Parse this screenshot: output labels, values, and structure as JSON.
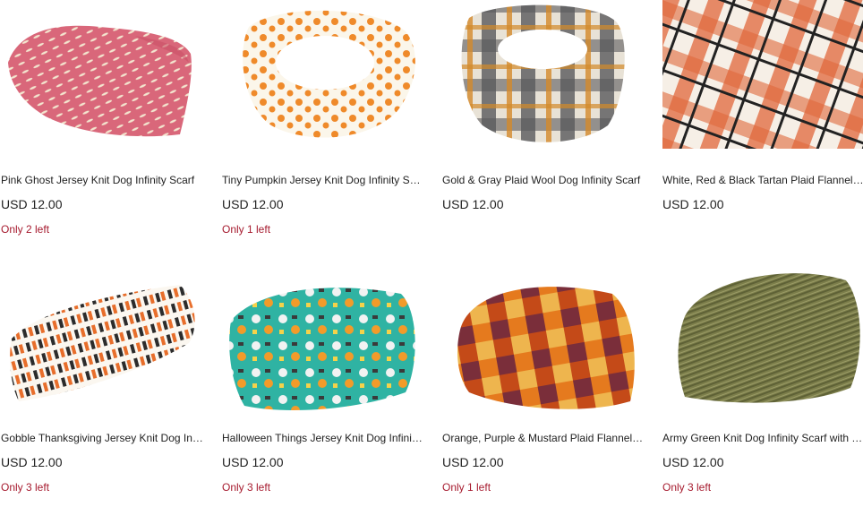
{
  "listings": [
    {
      "title": "Pink Ghost Jersey Knit Dog Infinity Scarf",
      "price": "USD 12.00",
      "stock": "Only 2 left",
      "image": "pink-ghost-scarf"
    },
    {
      "title": "Tiny Pumpkin Jersey Knit Dog Infinity Scarf",
      "price": "USD 12.00",
      "stock": "Only 1 left",
      "image": "tiny-pumpkin-scarf"
    },
    {
      "title": "Gold & Gray Plaid Wool Dog Infinity Scarf",
      "price": "USD 12.00",
      "stock": "",
      "image": "gold-gray-plaid-scarf"
    },
    {
      "title": "White, Red & Black Tartan Plaid Flannel Dog Infinity Scarf",
      "price": "USD 12.00",
      "stock": "",
      "image": "tartan-plaid-scarf"
    },
    {
      "title": "Gobble Thanksgiving Jersey Knit Dog Infinity Scarf",
      "price": "USD 12.00",
      "stock": "Only 3 left",
      "image": "gobble-scarf"
    },
    {
      "title": "Halloween Things Jersey Knit Dog Infinity Scarf",
      "price": "USD 12.00",
      "stock": "Only 3 left",
      "image": "halloween-scarf"
    },
    {
      "title": "Orange, Purple & Mustard Plaid Flannel Dog Infinity Scarf",
      "price": "USD 12.00",
      "stock": "Only 1 left",
      "image": "orange-purple-plaid-scarf"
    },
    {
      "title": "Army Green Knit Dog Infinity Scarf with Twist",
      "price": "USD 12.00",
      "stock": "Only 3 left",
      "image": "army-green-scarf"
    }
  ]
}
